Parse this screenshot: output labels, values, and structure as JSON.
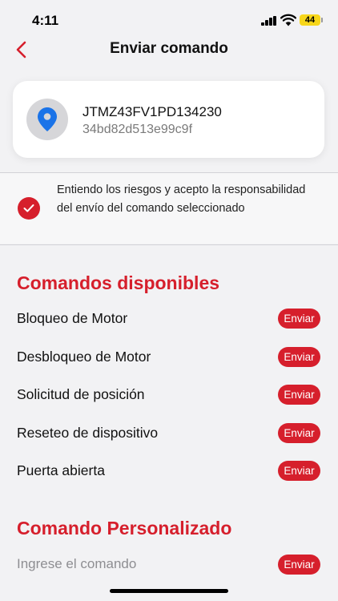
{
  "status_bar": {
    "time": "4:11",
    "battery": "44",
    "icons": [
      "signal-icon",
      "wifi-icon",
      "battery-icon"
    ]
  },
  "nav": {
    "title": "Enviar comando",
    "back_icon": "chevron-left-icon"
  },
  "device": {
    "icon": "location-pin-icon",
    "id": "JTMZ43FV1PD134230",
    "hash": "34bd82d513e99c9f"
  },
  "acceptance": {
    "checked": true,
    "text": "Entiendo los riesgos y acepto la responsabilidad del envío del comando seleccionado"
  },
  "available_commands": {
    "title": "Comandos disponibles",
    "items": [
      {
        "label": "Bloqueo de Motor",
        "button": "Enviar"
      },
      {
        "label": "Desbloqueo de Motor",
        "button": "Enviar"
      },
      {
        "label": "Solicitud de posición",
        "button": "Enviar"
      },
      {
        "label": "Reseteo de dispositivo",
        "button": "Enviar"
      },
      {
        "label": "Puerta abierta",
        "button": "Enviar"
      }
    ]
  },
  "custom_command": {
    "title": "Comando Personalizado",
    "placeholder": "Ingrese el comando",
    "button": "Enviar"
  },
  "colors": {
    "accent": "#d61f2c",
    "pin": "#1a73e8",
    "battery": "#f7d61a"
  }
}
